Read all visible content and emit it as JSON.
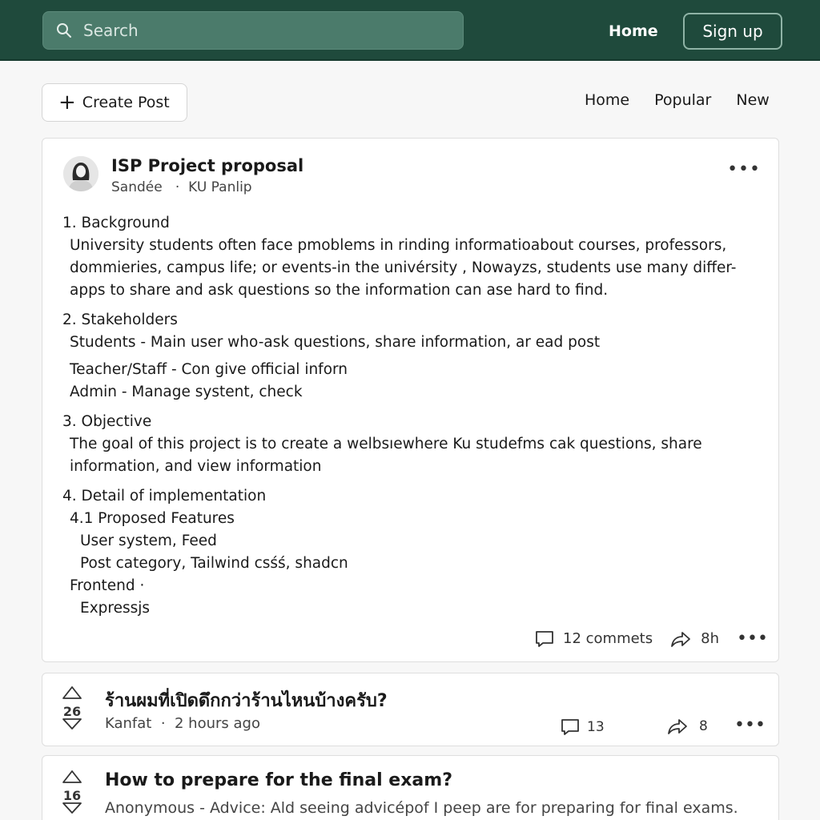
{
  "header": {
    "search_placeholder": "Search",
    "home_label": "Home",
    "signup_label": "Sign up"
  },
  "toolbar": {
    "create_label": "Create Post",
    "tabs": [
      "Home",
      "Popular",
      "New"
    ]
  },
  "post": {
    "title": "ISP Project proposal",
    "author": "Sandée",
    "community": "KU Panlip",
    "lines": [
      "1. Background",
      "University students often face pmoblems in rinding informatioabout courses, professors,",
      "dommieries, campus life; or events-in the univérsity , Nowayzs, students use many differ-",
      "apps to share and ask questions so the information can ase hard to find.",
      "2. Stakeholders",
      "Students - Main user who-ask questions, share information, ar ead post",
      "Teacher/Staff - Con give official inforn",
      "Admin - Manage systent, check",
      "3. Objective",
      "The goal of this project is to create a welbsıewhere Ku studefms cak questions, share",
      "information, and view information",
      "4. Detail of implementation",
      "4.1 Proposed Features",
      "User system, Feed",
      "Post category, Tailwind csśś, shadcn",
      "Frontend ·",
      "Expressjs"
    ],
    "comments": "12 commets",
    "age": "8h"
  },
  "feed": [
    {
      "votes": "26",
      "title": "ร้านผมที่เปิดดึกกว่าร้านไหนบ้างครับ?",
      "author": "Kanfat",
      "time": "2 hours ago",
      "comments": "13",
      "shares": "8"
    },
    {
      "votes": "16",
      "title": "How to prepare for the final exam?",
      "meta": "Anonymous - Advice: Ald seeing advicépof I peep are for preparing for final exams."
    }
  ]
}
